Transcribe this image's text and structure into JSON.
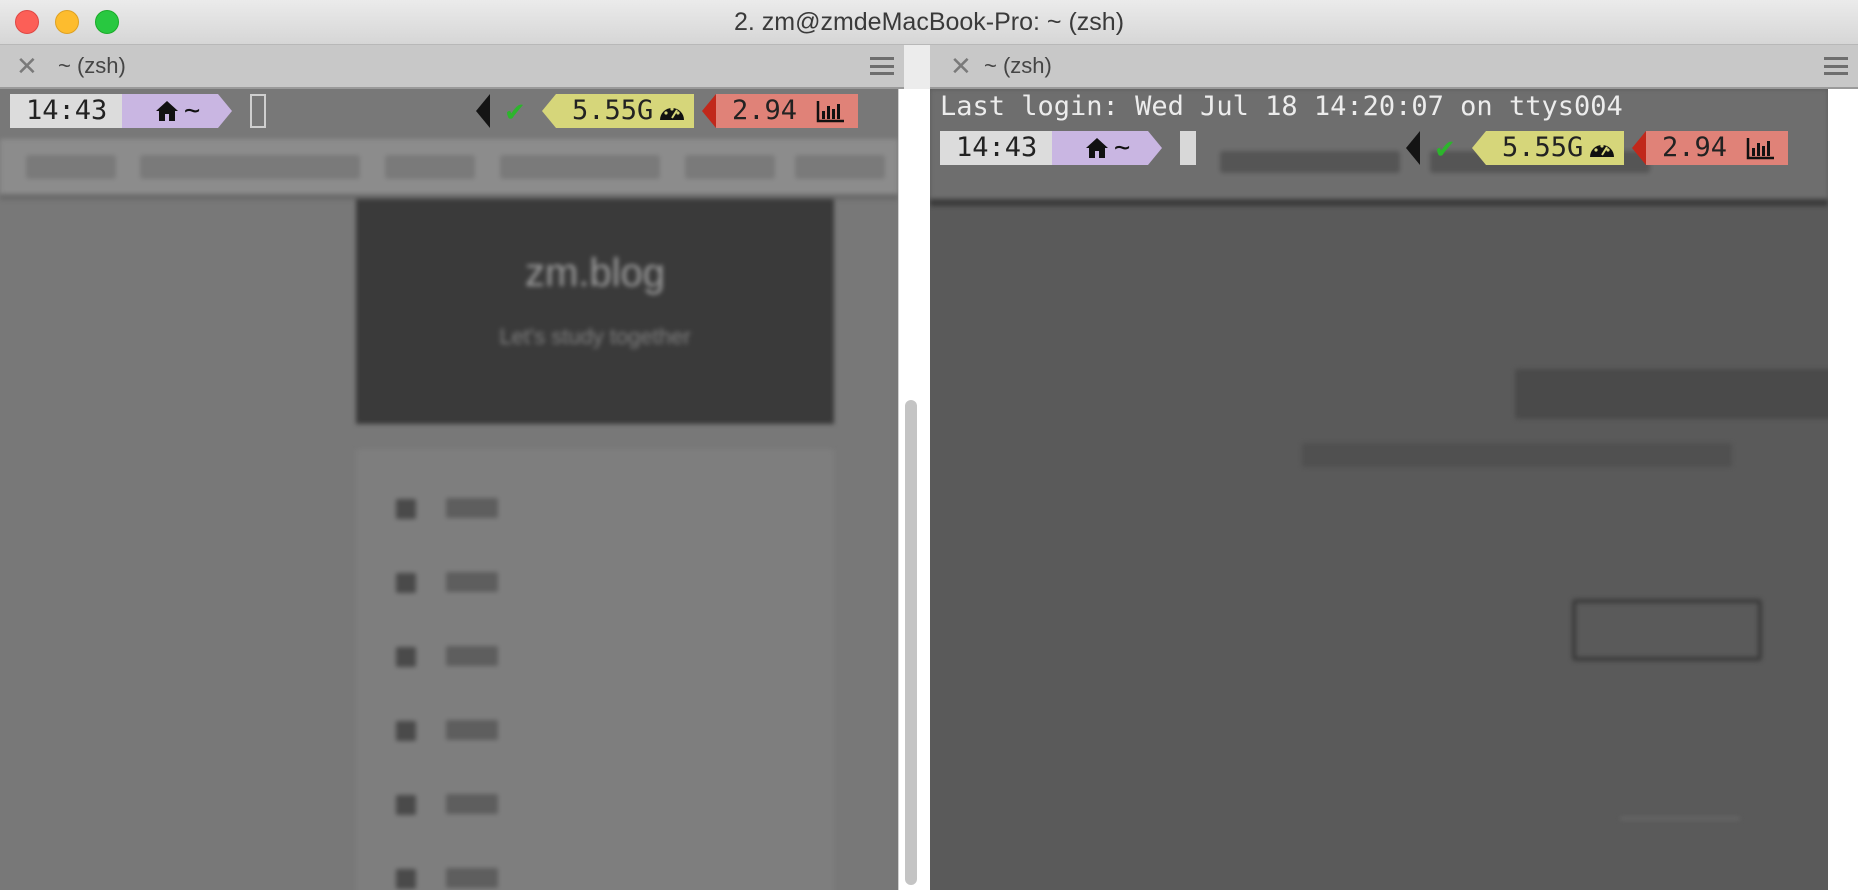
{
  "window": {
    "title": "2. zm@zmdeMacBook-Pro: ~ (zsh)"
  },
  "panes": {
    "left": {
      "tab_label": "~ (zsh)"
    },
    "right": {
      "tab_label": "~ (zsh)"
    }
  },
  "terminal": {
    "last_login": "Last login: Wed Jul 18 14:20:07 on ttys004",
    "prompt": {
      "time": "14:43",
      "home_dir": "~",
      "memory": "5.55G",
      "load": "2.94",
      "status_icon": "check-icon",
      "home_icon": "home-icon",
      "memory_icon": "speedometer-icon",
      "load_icon": "bar-chart-icon"
    }
  },
  "background": {
    "blog_title": "zm.blog",
    "blog_subtitle": "Let's study together"
  },
  "colors": {
    "time_segment": "#dcdcdc",
    "home_segment": "#c9b6e2",
    "memory_segment": "#d6d67a",
    "load_segment": "#e08278",
    "status_ok": "#2cb52c"
  }
}
